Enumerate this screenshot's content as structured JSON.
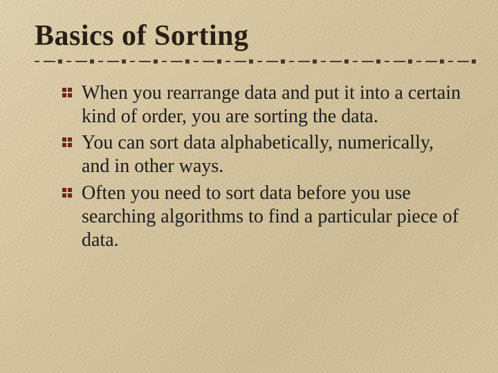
{
  "title": "Basics of Sorting",
  "bullets": [
    "When you rearrange data and put it into a certain kind of order, you are sorting the data.",
    "You can sort data alphabetically, numerically, and in other ways.",
    "Often you need to sort data before you use searching algorithms to find a particular piece of data."
  ]
}
